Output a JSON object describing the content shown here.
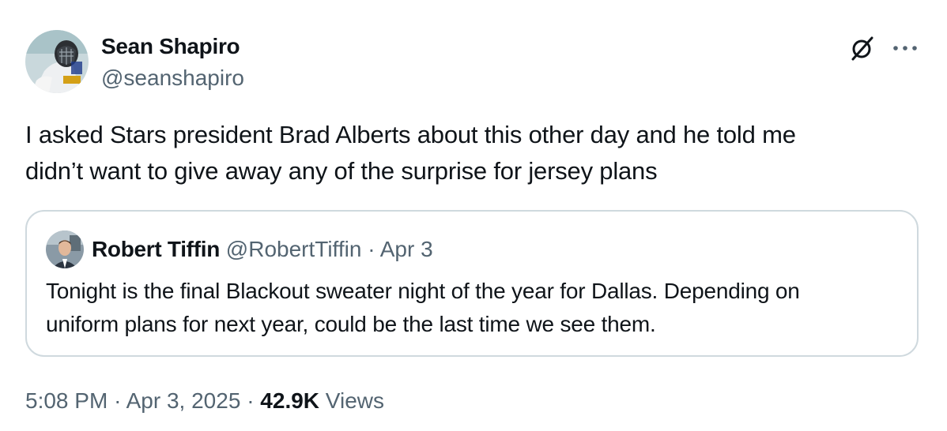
{
  "author": {
    "name": "Sean Shapiro",
    "handle": "@seanshapiro"
  },
  "tweet": {
    "text": "I asked Stars president Brad Alberts about this other day and he told me\ndidn’t want to give away any of the surprise for jersey plans"
  },
  "quoted_tweet": {
    "name": "Robert Tiffin",
    "handle": "@RobertTiffin",
    "separator": "·",
    "date": "Apr 3",
    "text": "Tonight is the final Blackout sweater night of the year for Dallas. Depending on\nuniform plans for next year, could be the last time we see them."
  },
  "meta": {
    "time": "5:08 PM",
    "separator": "·",
    "date": "Apr 3, 2025",
    "views_count": "42.9K",
    "views_label": "Views"
  },
  "icons": {
    "grok": "slashed-circle-icon",
    "more": "ellipsis-icon"
  },
  "colors": {
    "text_primary": "#0f1419",
    "text_secondary": "#536471",
    "border": "#cfd9de"
  }
}
